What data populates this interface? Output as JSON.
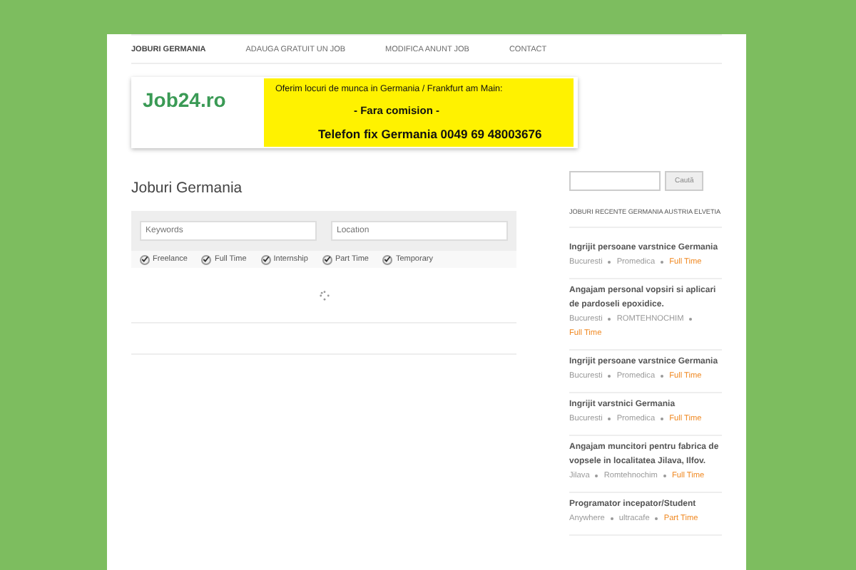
{
  "nav": [
    {
      "label": "JOBURI GERMANIA",
      "selected": true
    },
    {
      "label": "ADAUGA GRATUIT UN JOB",
      "selected": false
    },
    {
      "label": "MODIFICA ANUNT JOB",
      "selected": false
    },
    {
      "label": "CONTACT",
      "selected": false
    }
  ],
  "banner": {
    "logo": "Job24.ro",
    "lines": [
      "Oferim locuri de munca in Germania / Frankfurt am Main:",
      "- Fara comision -",
      "Telefon fix Germania 0049 69 48003676"
    ]
  },
  "page_title": "Joburi Germania",
  "search": {
    "keywords_placeholder": "Keywords",
    "location_placeholder": "Location"
  },
  "job_types": [
    {
      "label": "Freelance",
      "checked": true
    },
    {
      "label": "Full Time",
      "checked": true
    },
    {
      "label": "Internship",
      "checked": true
    },
    {
      "label": "Part Time",
      "checked": true
    },
    {
      "label": "Temporary",
      "checked": true
    }
  ],
  "sidebar": {
    "search_button": "Caută",
    "heading": "JOBURI RECENTE GERMANIA AUSTRIA ELVETIA",
    "jobs": [
      {
        "title": "Ingrijit persoane varstnice Germania",
        "location": "Bucuresti",
        "company": "Promedica",
        "type": "Full Time"
      },
      {
        "title": "Angajam personal vopsiri si aplicari de pardoseli epoxidice.",
        "location": "Bucuresti",
        "company": "ROMTEHNOCHIM",
        "type": "Full Time"
      },
      {
        "title": "Ingrijit persoane varstnice Germania",
        "location": "Bucuresti",
        "company": "Promedica",
        "type": "Full Time"
      },
      {
        "title": "Ingrijit varstnici Germania",
        "location": "Bucuresti",
        "company": "Promedica",
        "type": "Full Time"
      },
      {
        "title": "Angajam muncitori pentru fabrica de vopsele in localitatea Jilava, Ilfov.",
        "location": "Jilava",
        "company": "Romtehnochim",
        "type": "Full Time"
      },
      {
        "title": "Programator incepator/Student",
        "location": "Anywhere",
        "company": "ultracafe",
        "type": "Part Time"
      }
    ]
  }
}
